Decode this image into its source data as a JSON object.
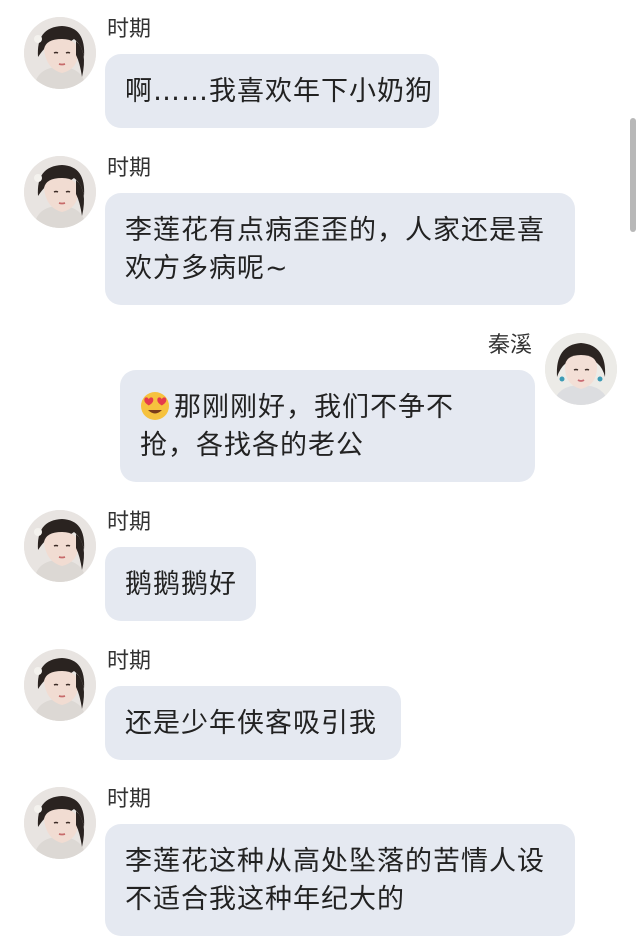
{
  "messages": [
    {
      "sender": "时期",
      "side": "left",
      "lines": [
        "啊……我喜欢年下小奶狗"
      ]
    },
    {
      "sender": "时期",
      "side": "left",
      "lines": [
        "李莲花有点病歪歪的，人家还是喜",
        "欢方多病呢~"
      ]
    },
    {
      "sender": "秦溪",
      "side": "right",
      "emoji": "heart-eyes-emoji",
      "lines": [
        "那刚刚好，我们不争不",
        "抢，各找各的老公"
      ]
    },
    {
      "sender": "时期",
      "side": "left",
      "lines": [
        "鹅鹅鹅好"
      ]
    },
    {
      "sender": "时期",
      "side": "left",
      "lines": [
        "还是少年侠客吸引我"
      ]
    },
    {
      "sender": "时期",
      "side": "left",
      "lines": [
        "李莲花这种从高处坠落的苦情人设",
        "不适合我这种年纪大的"
      ]
    }
  ],
  "colors": {
    "bubble": "#e5e9f1",
    "text": "#222222",
    "name": "#333333",
    "scrollbar": "#b8b8b8"
  }
}
